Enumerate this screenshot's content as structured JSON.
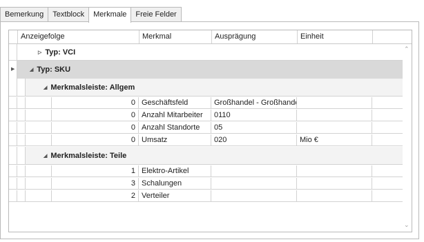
{
  "tabs": [
    "Bemerkung",
    "Textblock",
    "Merkmale",
    "Freie Felder"
  ],
  "active_tab": "Merkmale",
  "columns": {
    "anzeigefolge": "Anzeigefolge",
    "merkmal": "Merkmal",
    "auspraegung": "Ausprägung",
    "einheit": "Einheit"
  },
  "groups": {
    "typ_vci": "Typ: VCI",
    "typ_sku": "Typ: SKU",
    "leiste_allgem": "Merkmalsleiste: Allgem",
    "leiste_teile": "Merkmalsleiste: Teile"
  },
  "allgem_rows": [
    {
      "order": "0",
      "merkmal": "Geschäftsfeld",
      "auspraegung": "Großhandel - Großhandel",
      "einheit": ""
    },
    {
      "order": "0",
      "merkmal": "Anzahl Mitarbeiter",
      "auspraegung": "0110",
      "einheit": ""
    },
    {
      "order": "0",
      "merkmal": "Anzahl Standorte",
      "auspraegung": "05",
      "einheit": ""
    },
    {
      "order": "0",
      "merkmal": "Umsatz",
      "auspraegung": "020",
      "einheit": "Mio €"
    }
  ],
  "teile_rows": [
    {
      "order": "1",
      "merkmal": "Elektro-Artikel",
      "auspraegung": "",
      "einheit": ""
    },
    {
      "order": "3",
      "merkmal": "Schalungen",
      "auspraegung": "",
      "einheit": ""
    },
    {
      "order": "2",
      "merkmal": "Verteiler",
      "auspraegung": "",
      "einheit": ""
    }
  ],
  "icons": {
    "collapsed": "triangle-right",
    "expanded": "triangle-down-right",
    "row_pointer": "triangle-right",
    "scroll_up": "chevron-up",
    "scroll_down": "chevron-down"
  }
}
